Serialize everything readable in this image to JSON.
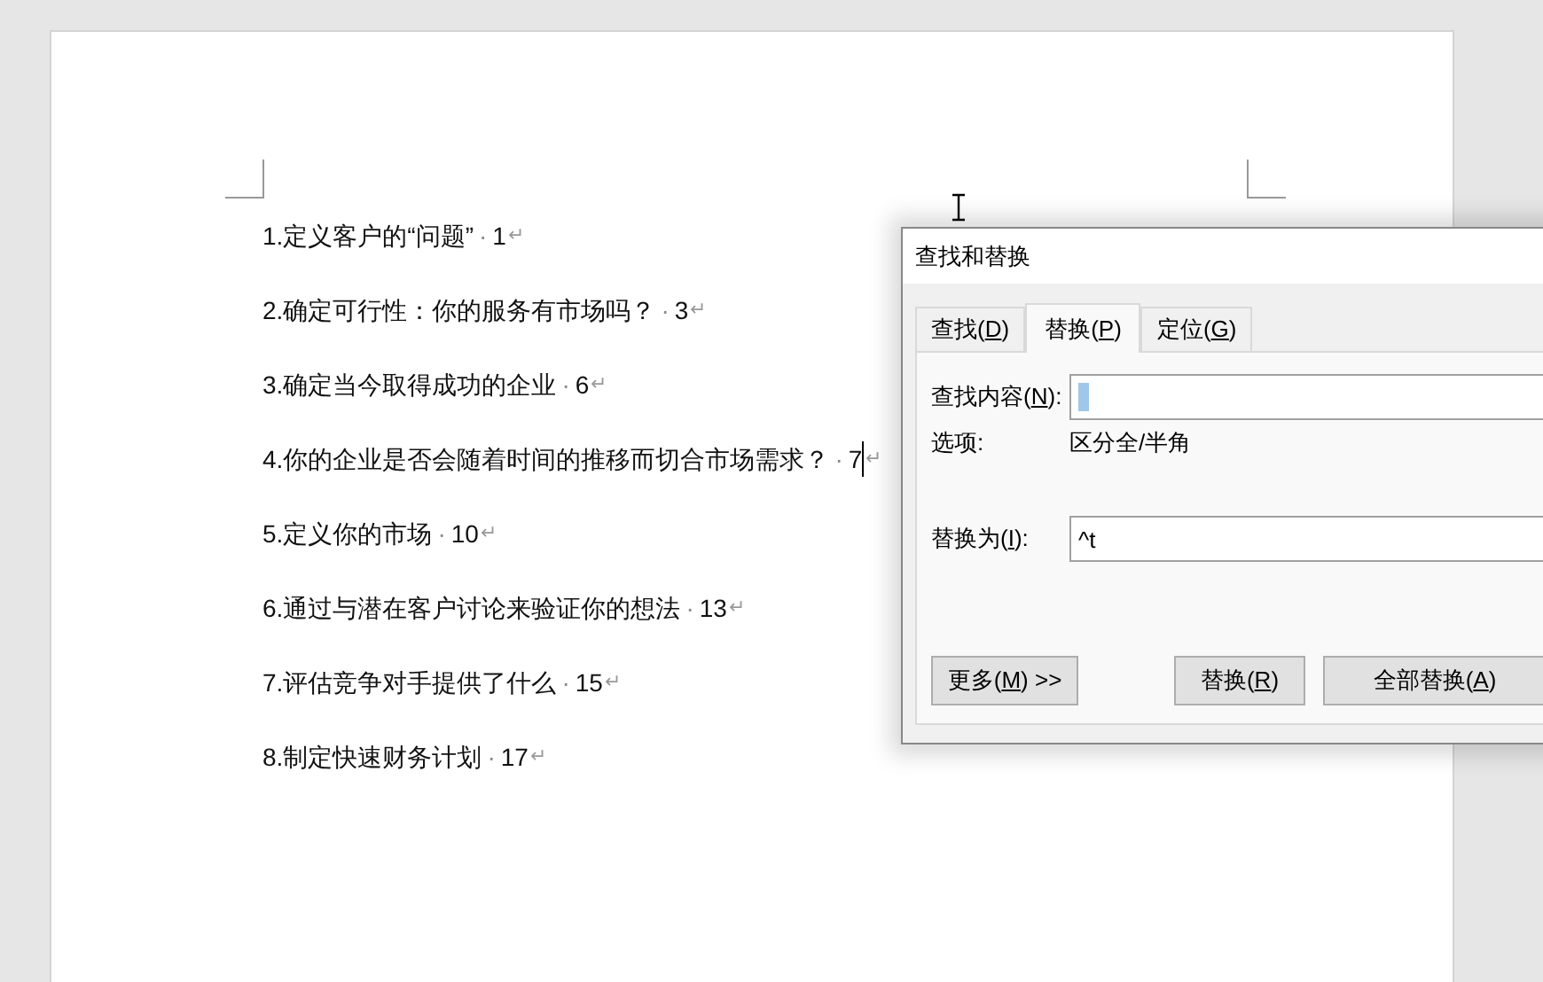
{
  "document": {
    "lines": [
      {
        "text": "1.定义客户的“问题”",
        "leader": "·",
        "page": "1",
        "mark": "↵",
        "caret": false
      },
      {
        "text": "2.确定可行性：你的服务有市场吗？",
        "leader": "·",
        "page": "3",
        "mark": "↵",
        "caret": false
      },
      {
        "text": "3.确定当今取得成功的企业",
        "leader": "·",
        "page": "6",
        "mark": "↵",
        "caret": false
      },
      {
        "text": "4.你的企业是否会随着时间的推移而切合市场需求？",
        "leader": "·",
        "page": "7",
        "mark": "↵",
        "caret": true
      },
      {
        "text": "5.定义你的市场",
        "leader": "·",
        "page": "10",
        "mark": "↵",
        "caret": false
      },
      {
        "text": "6.通过与潜在客户讨论来验证你的想法",
        "leader": "·",
        "page": "13",
        "mark": "↵",
        "caret": false
      },
      {
        "text": "7.评估竞争对手提供了什么",
        "leader": "·",
        "page": "15",
        "mark": "↵",
        "caret": false
      },
      {
        "text": "8.制定快速财务计划",
        "leader": "·",
        "page": "17",
        "mark": "↵",
        "caret": false
      }
    ]
  },
  "dialog": {
    "title": "查找和替换",
    "tabs": [
      {
        "before": "查找(",
        "key": "D",
        "after": ")",
        "selected": false
      },
      {
        "before": "替换(",
        "key": "P",
        "after": ")",
        "selected": true
      },
      {
        "before": "定位(",
        "key": "G",
        "after": ")",
        "selected": false
      }
    ],
    "find": {
      "before": "查找内容(",
      "key": "N",
      "after": "):"
    },
    "options": {
      "label": "选项:",
      "value": "区分全/半角"
    },
    "replace": {
      "before": "替换为(",
      "key": "I",
      "after": "):",
      "value": "^t"
    },
    "buttons": [
      {
        "before": "更多(",
        "key": "M",
        "after": ") >>"
      },
      {
        "before": "替换(",
        "key": "R",
        "after": ")"
      },
      {
        "before": "全部替换(",
        "key": "A",
        "after": ")"
      }
    ]
  }
}
